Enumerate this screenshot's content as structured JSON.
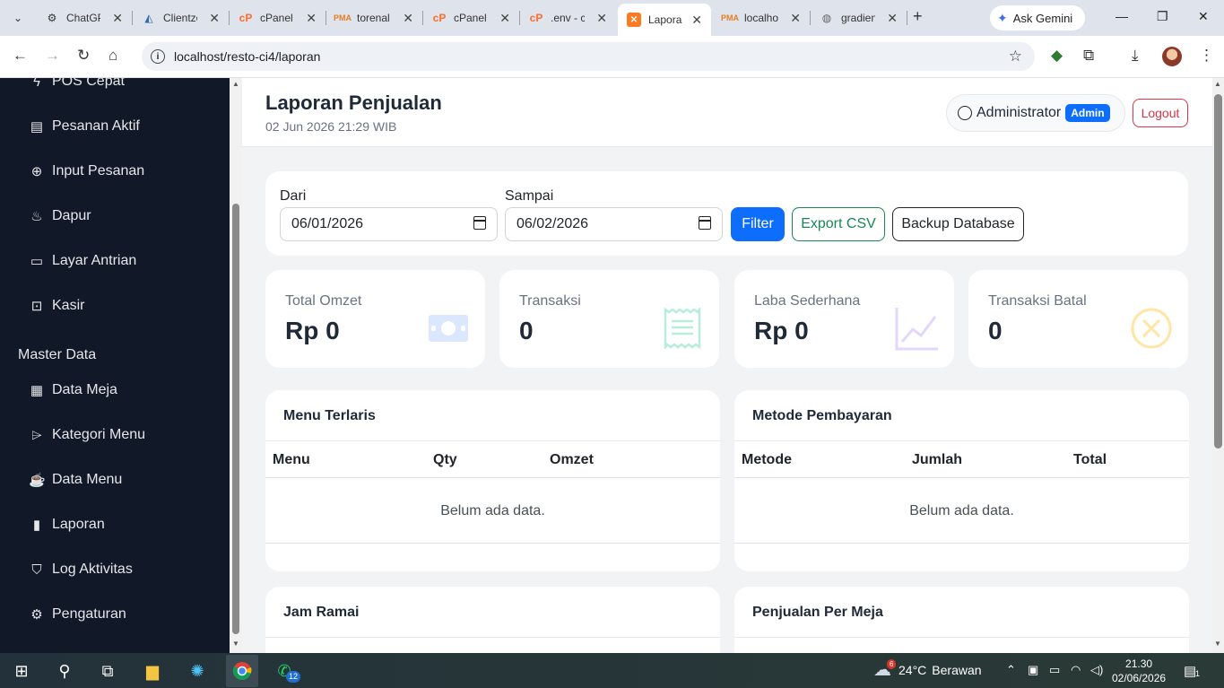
{
  "browser": {
    "tabs": [
      {
        "label": "ChatGPT",
        "favicon": "chatgpt-icon"
      },
      {
        "label": "Clientzone",
        "favicon": "clientzone-icon"
      },
      {
        "label": "cPanel",
        "favicon": "cpanel-icon"
      },
      {
        "label": "torenal",
        "favicon": "phpmyadmin-icon"
      },
      {
        "label": "cPanel",
        "favicon": "cpanel-icon"
      },
      {
        "label": ".env - c",
        "favicon": "cpanel-icon"
      },
      {
        "label": "Laporan",
        "favicon": "xampp-icon"
      },
      {
        "label": "localhost",
        "favicon": "phpmyadmin-icon"
      },
      {
        "label": "gradient",
        "favicon": "globe-icon"
      }
    ],
    "gemini_label": "Ask Gemini",
    "url": "localhost/resto-ci4/laporan"
  },
  "sidebar": {
    "items_top": [
      {
        "label": "POS Cepat",
        "icon": "lightning-icon"
      },
      {
        "label": "Pesanan Aktif",
        "icon": "receipt-icon"
      },
      {
        "label": "Input Pesanan",
        "icon": "plus-circle-icon"
      },
      {
        "label": "Dapur",
        "icon": "fire-icon"
      },
      {
        "label": "Layar Antrian",
        "icon": "display-icon"
      },
      {
        "label": "Kasir",
        "icon": "cash-icon"
      }
    ],
    "section_title": "Master Data",
    "items_master": [
      {
        "label": "Data Meja",
        "icon": "table-icon"
      },
      {
        "label": "Kategori Menu",
        "icon": "tag-icon"
      },
      {
        "label": "Data Menu",
        "icon": "cup-icon"
      },
      {
        "label": "Laporan",
        "icon": "bar-chart-icon"
      },
      {
        "label": "Log Aktivitas",
        "icon": "shield-icon"
      },
      {
        "label": "Pengaturan",
        "icon": "gear-icon"
      }
    ]
  },
  "header": {
    "title": "Laporan Penjualan",
    "subtitle": "02 Jun 2026 21:29 WIB",
    "user_name": "Administrator",
    "user_badge": "Admin",
    "logout_label": "Logout"
  },
  "filter": {
    "from_label": "Dari",
    "from_value": "06/01/2026",
    "to_label": "Sampai",
    "to_value": "06/02/2026",
    "filter_button": "Filter",
    "export_button": "Export CSV",
    "backup_button": "Backup Database"
  },
  "stats": [
    {
      "label": "Total Omzet",
      "value": "Rp 0",
      "icon": "cash-icon",
      "color": "#0d6efd"
    },
    {
      "label": "Transaksi",
      "value": "0",
      "icon": "receipt-icon",
      "color": "#20c997"
    },
    {
      "label": "Laba Sederhana",
      "value": "Rp 0",
      "icon": "graph-up-icon",
      "color": "#6f42c1"
    },
    {
      "label": "Transaksi Batal",
      "value": "0",
      "icon": "x-circle-icon",
      "color": "#ffc107"
    }
  ],
  "panels": {
    "menu_terlaris": {
      "title": "Menu Terlaris",
      "columns": [
        "Menu",
        "Qty",
        "Omzet"
      ],
      "empty": "Belum ada data."
    },
    "metode_pembayaran": {
      "title": "Metode Pembayaran",
      "columns": [
        "Metode",
        "Jumlah",
        "Total"
      ],
      "empty": "Belum ada data."
    },
    "jam_ramai": {
      "title": "Jam Ramai"
    },
    "penjualan_per_meja": {
      "title": "Penjualan Per Meja"
    }
  },
  "taskbar": {
    "weather_temp": "24°C",
    "weather_text": "Berawan",
    "time": "21.30",
    "date": "02/06/2026",
    "whatsapp_badge": "12",
    "weather_badge": "6",
    "notification_count": "1"
  }
}
